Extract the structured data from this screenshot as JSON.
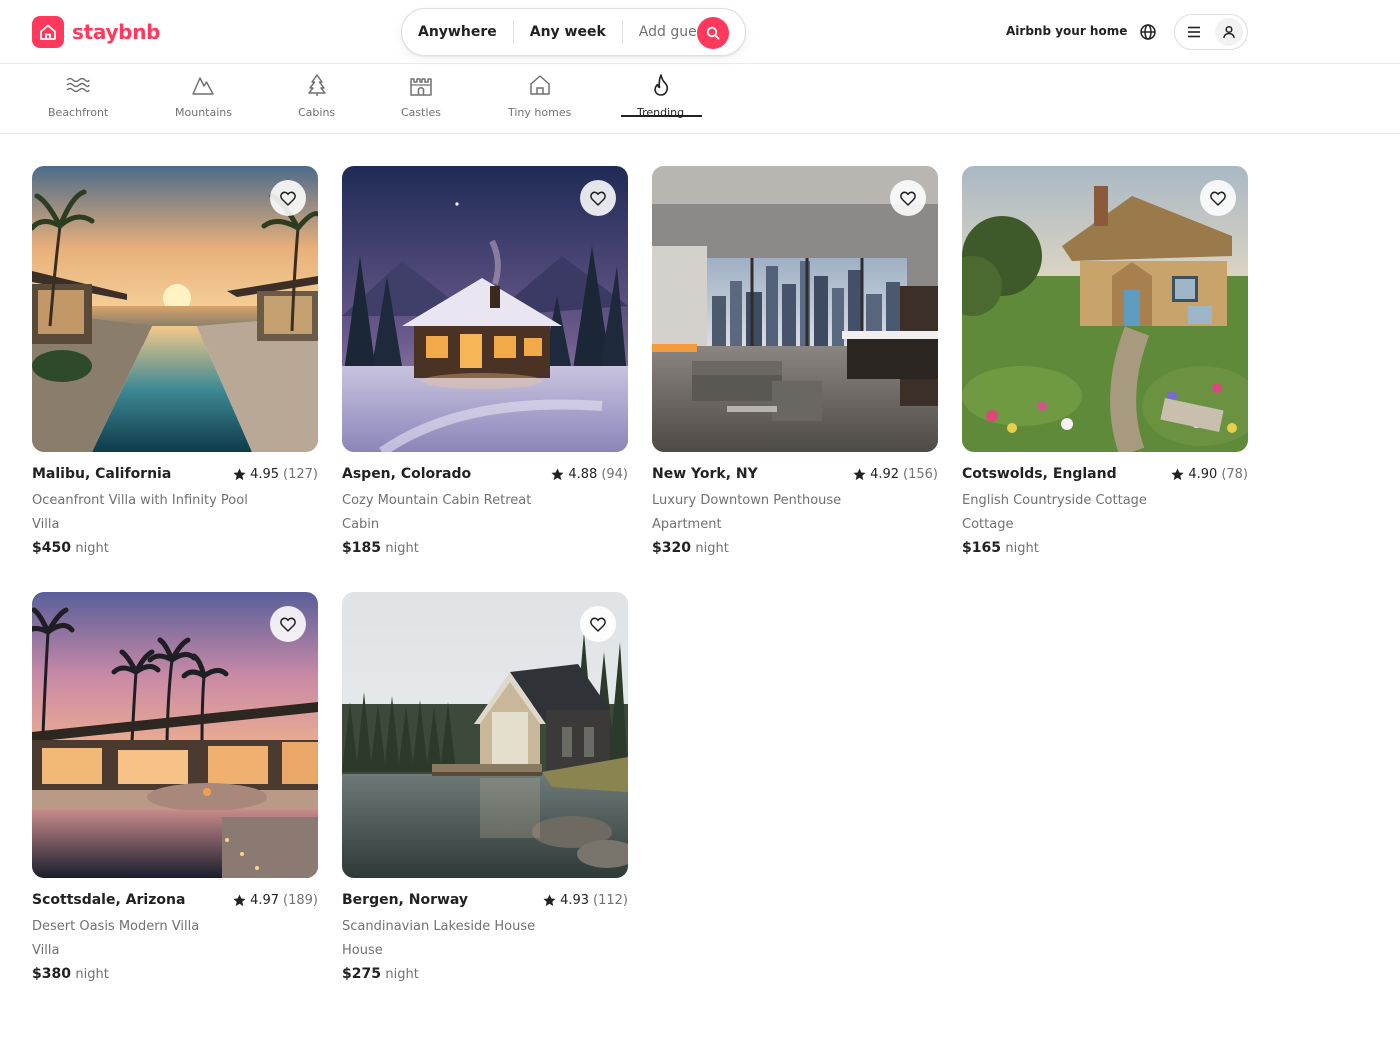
{
  "brand": {
    "name": "staybnb",
    "accent": "#ff385c",
    "icon": "house-icon"
  },
  "search": {
    "location": "Anywhere",
    "dates": "Any week",
    "guests": "Add guests",
    "icon": "search-icon"
  },
  "header": {
    "host_link": "Airbnb your home",
    "globe_icon": "globe-icon",
    "menu_icon": "menu-icon",
    "user_icon": "user-icon"
  },
  "categories": [
    {
      "label": "Beachfront",
      "icon": "waves-icon",
      "active": false
    },
    {
      "label": "Mountains",
      "icon": "mountain-icon",
      "active": false
    },
    {
      "label": "Cabins",
      "icon": "tree-icon",
      "active": false
    },
    {
      "label": "Castles",
      "icon": "castle-icon",
      "active": false
    },
    {
      "label": "Tiny homes",
      "icon": "house-icon",
      "active": false
    },
    {
      "label": "Trending",
      "icon": "flame-icon",
      "active": true
    }
  ],
  "listings": [
    {
      "location": "Malibu, California",
      "rating": "4.95",
      "reviews": "(127)",
      "title": "Oceanfront Villa with Infinity Pool",
      "type": "Villa",
      "price": "$450",
      "unit": "night"
    },
    {
      "location": "Aspen, Colorado",
      "rating": "4.88",
      "reviews": "(94)",
      "title": "Cozy Mountain Cabin Retreat",
      "type": "Cabin",
      "price": "$185",
      "unit": "night"
    },
    {
      "location": "New York, NY",
      "rating": "4.92",
      "reviews": "(156)",
      "title": "Luxury Downtown Penthouse",
      "type": "Apartment",
      "price": "$320",
      "unit": "night"
    },
    {
      "location": "Cotswolds, England",
      "rating": "4.90",
      "reviews": "(78)",
      "title": "English Countryside Cottage",
      "type": "Cottage",
      "price": "$165",
      "unit": "night"
    },
    {
      "location": "Scottsdale, Arizona",
      "rating": "4.97",
      "reviews": "(189)",
      "title": "Desert Oasis Modern Villa",
      "type": "Villa",
      "price": "$380",
      "unit": "night"
    },
    {
      "location": "Bergen, Norway",
      "rating": "4.93",
      "reviews": "(112)",
      "title": "Scandinavian Lakeside House",
      "type": "House",
      "price": "$275",
      "unit": "night"
    }
  ]
}
